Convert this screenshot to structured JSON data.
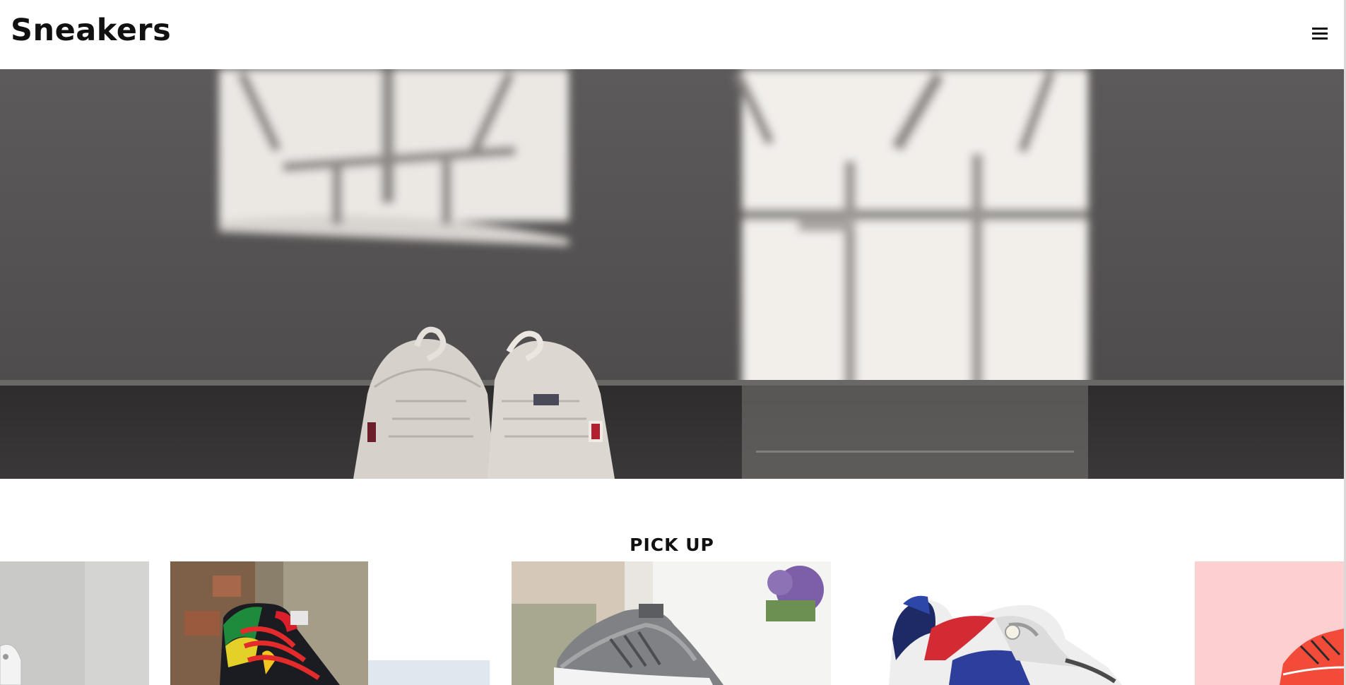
{
  "header": {
    "site_title": "Sneakers",
    "menu_icon": "hamburger-menu-icon"
  },
  "hero": {
    "image": "sneakers-on-floor-with-window-shadows"
  },
  "pickup": {
    "title": "PICK UP",
    "slides": [
      {
        "image": "white-sneaker-on-grey"
      },
      {
        "image": "colorful-high-top-sneaker-on-stone"
      },
      {
        "image": "grey-knit-running-shoe"
      },
      {
        "image": "navy-red-white-chunky-sneaker"
      },
      {
        "image": "red-sneaker-on-pink"
      }
    ]
  },
  "colors": {
    "text": "#111111",
    "background": "#ffffff"
  }
}
